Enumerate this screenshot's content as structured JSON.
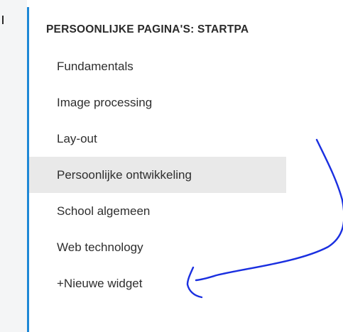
{
  "panel": {
    "title": "PERSOONLIJKE PAGINA'S: STARTPA"
  },
  "menu": {
    "items": [
      {
        "label": "Fundamentals"
      },
      {
        "label": "Image processing"
      },
      {
        "label": "Lay-out"
      },
      {
        "label": "Persoonlijke ontwikkeling",
        "active": true
      },
      {
        "label": "School algemeen"
      },
      {
        "label": "Web technology"
      }
    ],
    "new_widget_label": "+Nieuwe widget"
  },
  "colors": {
    "accent": "#1e88d6",
    "active_bg": "#e9e9e9",
    "annotation_ink": "#1a2fe0"
  }
}
